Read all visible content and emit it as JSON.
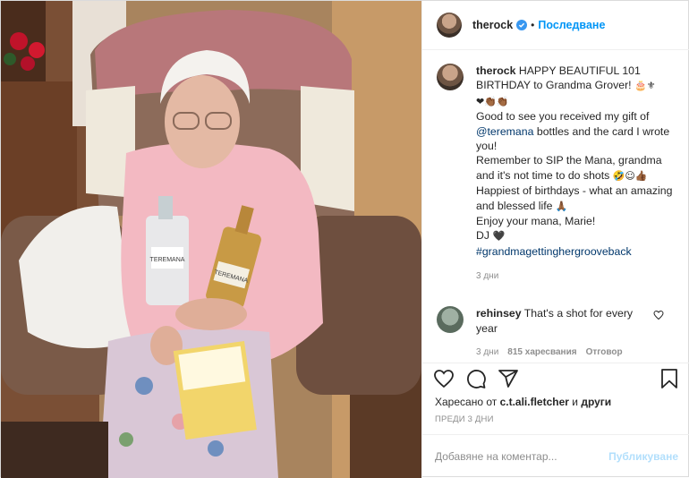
{
  "post": {
    "photo_alt": "",
    "author": "therock",
    "follow_label": "Последване",
    "caption": {
      "line1": "HAPPY BEAUTIFUL 101 BIRTHDAY to Grandma Grover!",
      "line1_emoji": "🎂⚜",
      "hearts_emoji": "❤👏🏾👏🏾",
      "p2_pre": "Good to see you received my gift of ",
      "mention": "@teremana",
      "p2_post": " bottles and the card I wrote you!",
      "p3": "Remember to SIP the Mana, grandma and it's not time to do shots ",
      "p3_emoji": "🤣☺👍🏾",
      "p4": "Happiest of birthdays - what an amazing and blessed life ",
      "p4_emoji": "🙏🏾",
      "p5": "Enjoy your mana, Marie!",
      "p6": "DJ ",
      "p6_emoji": "🖤",
      "hashtag": "#grandmagettinghergrooveback",
      "age": "3 дни"
    },
    "reply": {
      "author": "rehinsey",
      "text": "That's a shot for every year",
      "age": "3 дни",
      "likes": "815 харесвания",
      "reply_label": "Отговор"
    },
    "likes_prefix": "Харесано от ",
    "likes_user": "c.t.ali.fletcher",
    "likes_mid": " и ",
    "likes_suffix": "други",
    "timestamp": "ПРЕДИ 3 ДНИ",
    "add_comment_placeholder": "Добавяне на коментар...",
    "publish_label": "Публикуване"
  },
  "colors": {
    "link_blue": "#0095f6",
    "publish_disabled": "#b2dffc",
    "hashtag": "#00376b",
    "muted": "#8e8e8e"
  },
  "icons": [
    "verified-badge-icon",
    "heart-icon",
    "comment-icon",
    "share-icon",
    "bookmark-icon",
    "small-heart-icon"
  ]
}
